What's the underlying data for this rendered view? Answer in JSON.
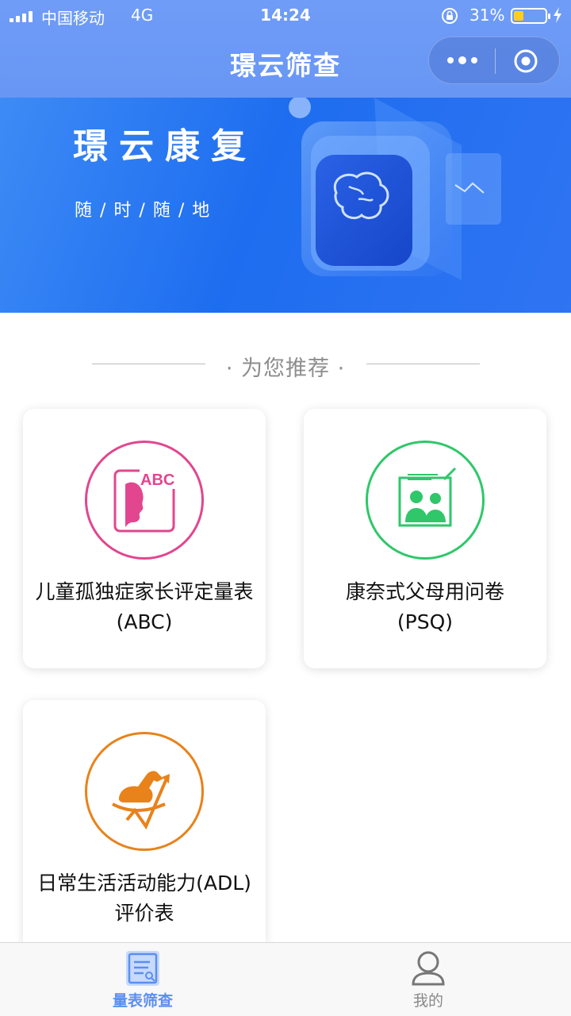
{
  "status_bar": {
    "carrier": "中国移动",
    "network": "4G",
    "time": "14:24",
    "battery_percent": "31%",
    "battery_level": 0.31
  },
  "nav": {
    "title": "璟云筛查",
    "more_icon": "more-dots-icon",
    "close_icon": "target-circle-icon"
  },
  "banner": {
    "title": "璟云康复",
    "subtitle": "随/时/随/地"
  },
  "section": {
    "heading": "· 为您推荐 ·"
  },
  "cards": [
    {
      "line1": "儿童孤独症家长评定量表",
      "line2": "(ABC)",
      "icon": "abc-face-icon",
      "color": "#e2468f",
      "icon_text": "ABC"
    },
    {
      "line1": "康奈式父母用问卷",
      "line2": "(PSQ)",
      "icon": "parents-portrait-icon",
      "color": "#2fc76a"
    },
    {
      "line1": "日常生活活动能力(ADL)",
      "line2": "评价表",
      "icon": "rocking-horse-icon",
      "color": "#e8821a"
    }
  ],
  "tabbar": {
    "tabs": [
      {
        "label": "量表筛查",
        "icon": "scale-document-icon",
        "active": true,
        "color": "#5b8ef0"
      },
      {
        "label": "我的",
        "icon": "user-profile-icon",
        "active": false,
        "color": "#888888"
      }
    ]
  }
}
